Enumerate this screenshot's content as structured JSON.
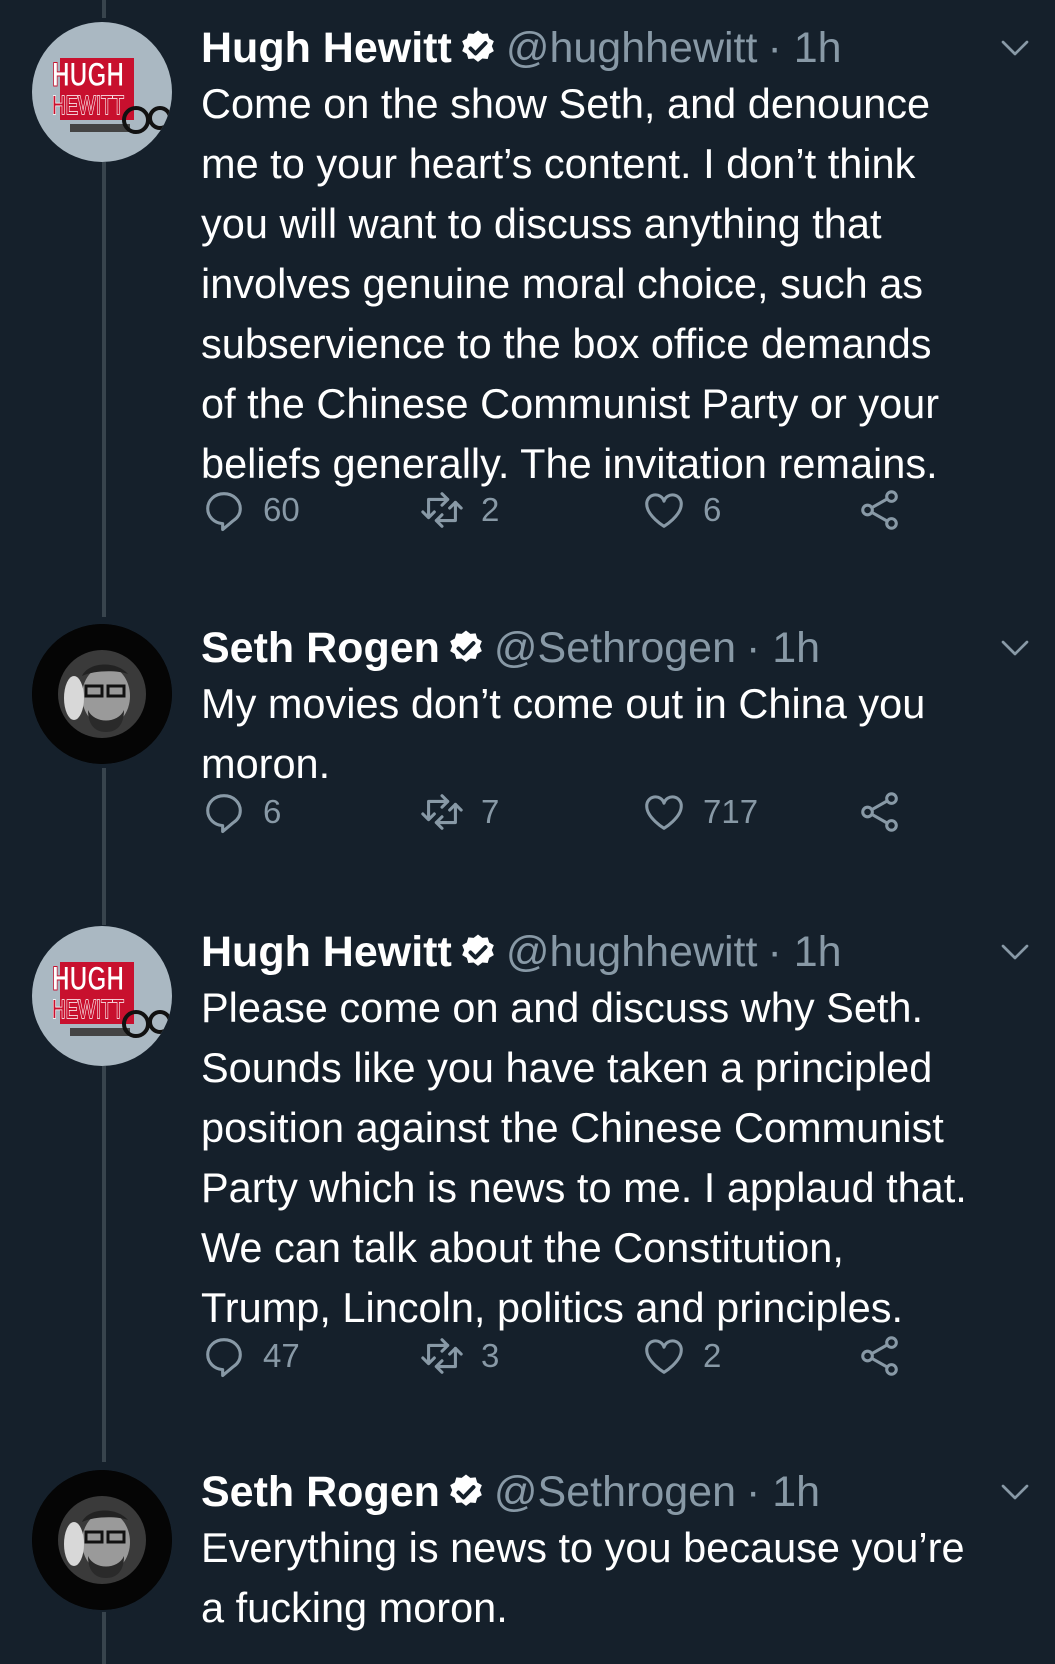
{
  "colors": {
    "background": "#15202b",
    "text": "#ffffff",
    "secondary": "#8899a6",
    "thread_line": "#38444d"
  },
  "avatar_text": {
    "hugh_line1": "HUGH",
    "hugh_line2": "HEWITT"
  },
  "tweets": [
    {
      "name": "Hugh Hewitt",
      "verified": true,
      "handle": "@hughhewitt",
      "time": "· 1h",
      "text": "Come on the show Seth, and denounce\nme to your heart’s content. I don’t think\nyou will want to discuss anything that\ninvolves genuine moral choice, such as\nsubservience to the box office demands\nof the Chinese Communist Party or your\nbeliefs generally. The invitation remains.",
      "replies": "60",
      "retweets": "2",
      "likes": "6"
    },
    {
      "name": "Seth Rogen",
      "verified": true,
      "handle": "@Sethrogen",
      "time": "· 1h",
      "text": "My movies don’t come out in China you\nmoron.",
      "replies": "6",
      "retweets": "7",
      "likes": "717"
    },
    {
      "name": "Hugh Hewitt",
      "verified": true,
      "handle": "@hughhewitt",
      "time": "· 1h",
      "text": "Please come on and discuss why Seth.\nSounds like you have taken a principled\nposition against the Chinese Communist\nParty which is news to me. I applaud that.\nWe can talk about the Constitution,\nTrump, Lincoln, politics and principles.",
      "replies": "47",
      "retweets": "3",
      "likes": "2"
    },
    {
      "name": "Seth Rogen",
      "verified": true,
      "handle": "@Sethrogen",
      "time": "· 1h",
      "text": "Everything is news to you because you’re\na fucking moron."
    }
  ]
}
